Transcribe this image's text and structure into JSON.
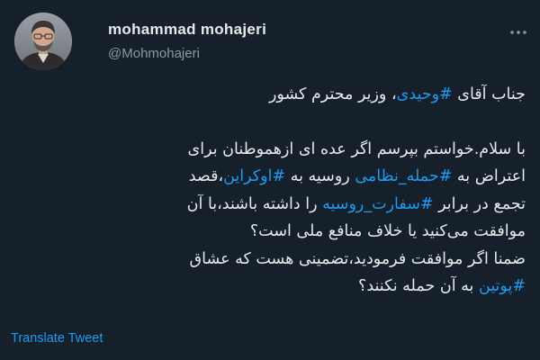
{
  "tweet": {
    "display_name": "mohammad mohajeri",
    "handle": "@Mohmohajeri",
    "more_icon": "more-dots-icon",
    "lines": [
      [
        {
          "t": "جناب آقای ",
          "tag": false
        },
        {
          "t": "#وحیدی",
          "tag": true
        },
        {
          "t": "، وزیر محترم کشور",
          "tag": false
        }
      ],
      [],
      [
        {
          "t": "با سلام.خواستم بپرسم اگر عده ای ازهموطنان برای",
          "tag": false
        }
      ],
      [
        {
          "t": "اعتراض به ",
          "tag": false
        },
        {
          "t": "#حمله_نظامی",
          "tag": true
        },
        {
          "t": " روسیه به ",
          "tag": false
        },
        {
          "t": "#اوکراین",
          "tag": true
        },
        {
          "t": "،قصد",
          "tag": false
        }
      ],
      [
        {
          "t": "تجمع در برابر ",
          "tag": false
        },
        {
          "t": "#سفارت_روسیه",
          "tag": true
        },
        {
          "t": " را داشته باشند،با آن",
          "tag": false
        }
      ],
      [
        {
          "t": "موافقت می‌کنید یا خلاف منافع ملی است؟",
          "tag": false
        }
      ],
      [
        {
          "t": "ضمنا اگر موافقت فرمودید،تضمینی هست که عشاق",
          "tag": false
        }
      ],
      [
        {
          "t": "#پوتین",
          "tag": true
        },
        {
          "t": " به آن حمله نکنند؟",
          "tag": false
        }
      ]
    ],
    "translate_label": "Translate Tweet"
  },
  "colors": {
    "background": "#15202b",
    "text": "#e7e9ea",
    "secondary_text": "#8b98a5",
    "accent": "#1d9bf0"
  }
}
